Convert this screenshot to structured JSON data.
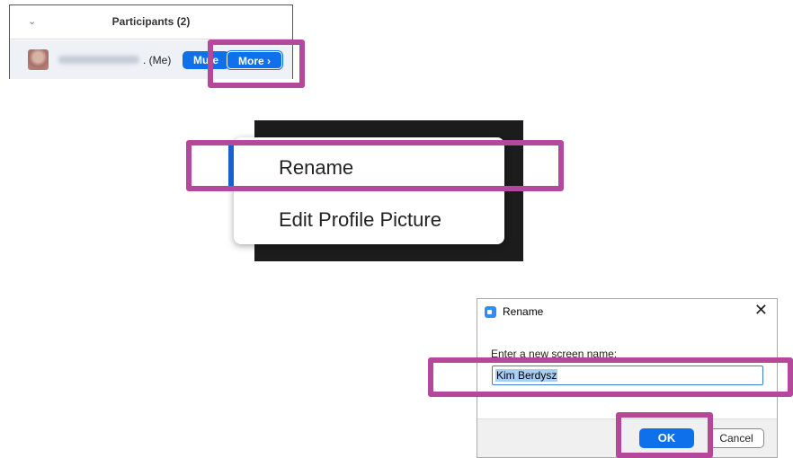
{
  "participants_panel": {
    "collapse_icon": "chevron-down-icon",
    "title": "Participants (2)",
    "row": {
      "me_suffix": ". (Me)",
      "mute_label": "Mute",
      "more_label": "More ›"
    }
  },
  "context_menu": {
    "items": [
      {
        "label": "Rename"
      },
      {
        "label": "Edit Profile Picture"
      }
    ]
  },
  "rename_dialog": {
    "title": "Rename",
    "close_glyph": "✕",
    "prompt": "Enter a new screen name:",
    "value": "Kim Berdysz",
    "ok_label": "OK",
    "cancel_label": "Cancel"
  },
  "colors": {
    "highlight": "#b5489a",
    "zoom_blue": "#0e71eb",
    "menu_accent": "#1a5fd0"
  }
}
